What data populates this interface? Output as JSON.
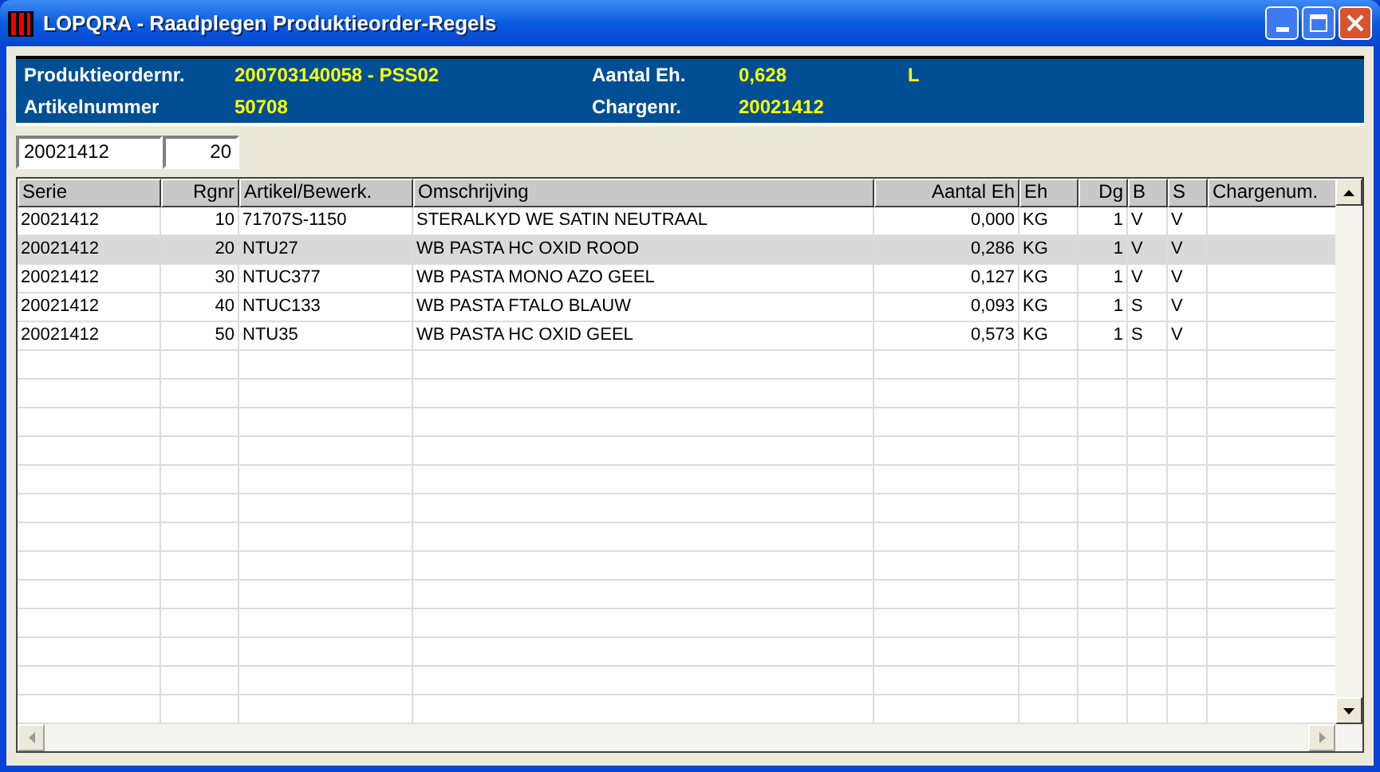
{
  "window": {
    "title": "LOPQRA - Raadplegen Produktieorder-Regels"
  },
  "header": {
    "fields": [
      {
        "label": "Produktieordernr.",
        "value": "200703140058 - PSS02"
      },
      {
        "label": "Aantal Eh.",
        "value": "0,628",
        "unit": "L"
      },
      {
        "label": "Artikelnummer",
        "value": "50708"
      },
      {
        "label": "Chargenr.",
        "value": "20021412"
      }
    ]
  },
  "filter": {
    "serie": "20021412",
    "regel": "20"
  },
  "table": {
    "columns": [
      "Serie",
      "Rgnr",
      "Artikel/Bewerk.",
      "Omschrijving",
      "Aantal Eh",
      "Eh",
      "Dg",
      "B",
      "S",
      "Chargenum."
    ],
    "rows": [
      {
        "selected": false,
        "cells": [
          "20021412",
          "10",
          "71707S-1150",
          "STERALKYD WE SATIN NEUTRAAL",
          "0,000",
          "KG",
          "1",
          "V",
          "V"
        ]
      },
      {
        "selected": true,
        "cells": [
          "20021412",
          "20",
          "NTU27",
          "WB PASTA HC OXID ROOD",
          "0,286",
          "KG",
          "1",
          "V",
          "V"
        ]
      },
      {
        "selected": false,
        "cells": [
          "20021412",
          "30",
          "NTUC377",
          "WB PASTA MONO AZO GEEL",
          "0,127",
          "KG",
          "1",
          "V",
          "V"
        ]
      },
      {
        "selected": false,
        "cells": [
          "20021412",
          "40",
          "NTUC133",
          "WB PASTA FTALO BLAUW",
          "0,093",
          "KG",
          "1",
          "S",
          "V"
        ]
      },
      {
        "selected": false,
        "cells": [
          "20021412",
          "50",
          "NTU35",
          "WB PASTA HC OXID GEEL",
          "0,573",
          "KG",
          "1",
          "S",
          "V"
        ]
      }
    ]
  }
}
